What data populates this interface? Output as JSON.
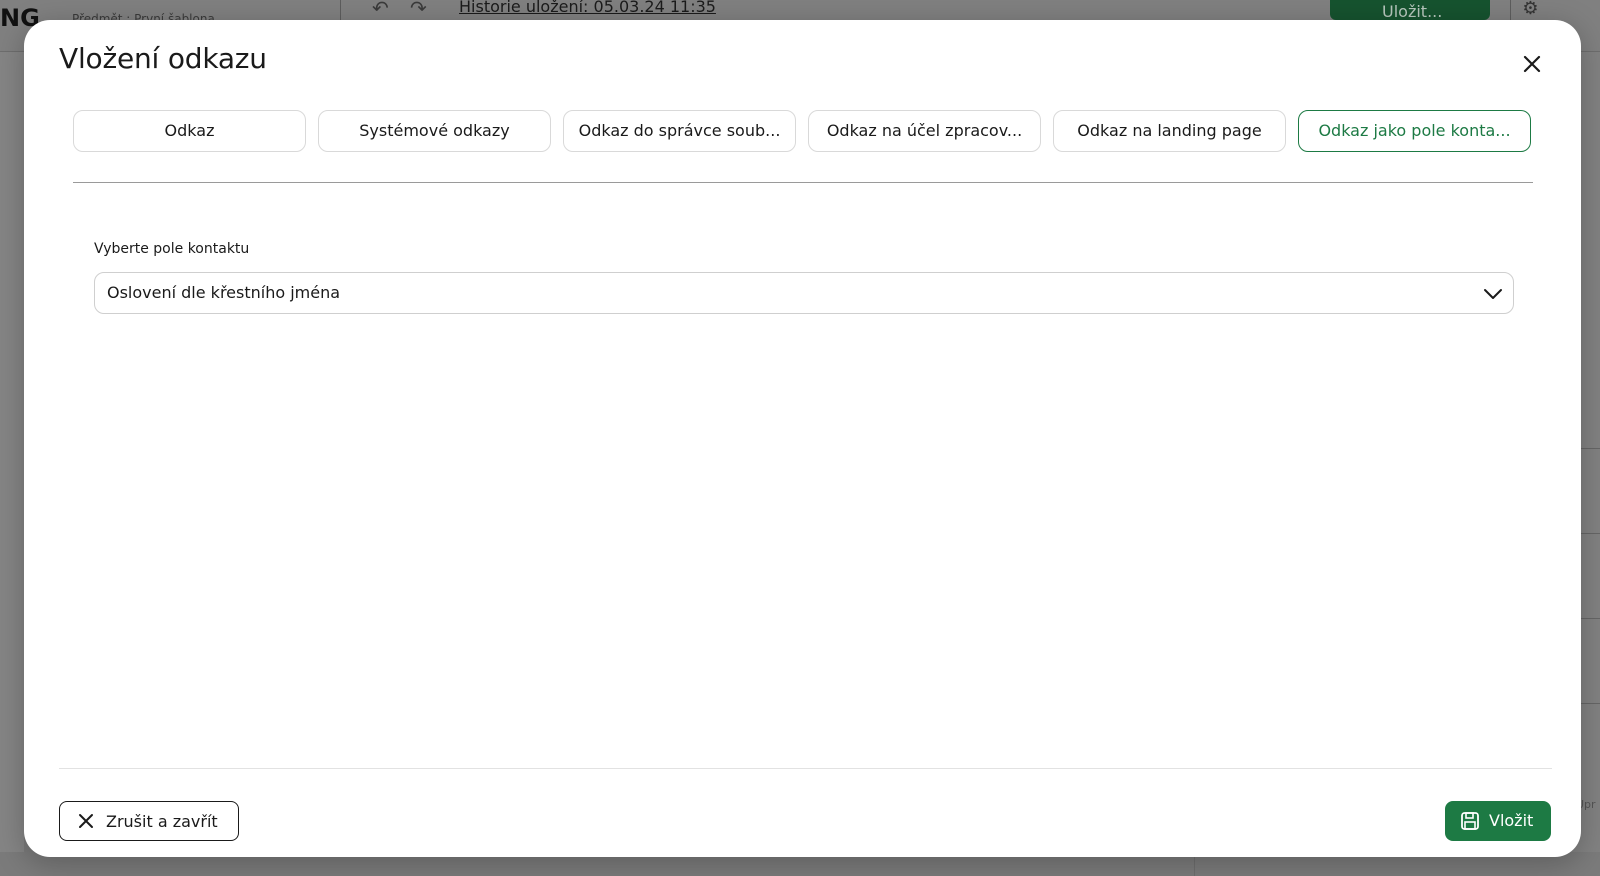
{
  "background": {
    "logo_text": "NG",
    "subject_text": "Předmět : První šablona",
    "history_label": "Historie uložení: 05.03.24 11:35",
    "save_label": "Uložit...",
    "side_text": "Úpr"
  },
  "modal": {
    "title": "Vložení odkazu",
    "tabs": [
      {
        "label": "Odkaz",
        "active": false
      },
      {
        "label": "Systémové odkazy",
        "active": false
      },
      {
        "label": "Odkaz do správce soub...",
        "active": false
      },
      {
        "label": "Odkaz na účel zpracov...",
        "active": false
      },
      {
        "label": "Odkaz na landing page",
        "active": false
      },
      {
        "label": "Odkaz jako pole konta...",
        "active": true
      }
    ],
    "field": {
      "label": "Vyberte pole kontaktu",
      "selected_value": "Oslovení dle křestního jména"
    },
    "footer": {
      "cancel_label": "Zrušit a zavřít",
      "insert_label": "Vložit"
    }
  },
  "colors": {
    "accent": "#1d7a44",
    "overlay": "#7b7b7b"
  },
  "icons": [
    "close-icon",
    "chevron-down-icon",
    "x-icon",
    "save-icon",
    "undo-icon",
    "redo-icon",
    "gear-icon"
  ]
}
